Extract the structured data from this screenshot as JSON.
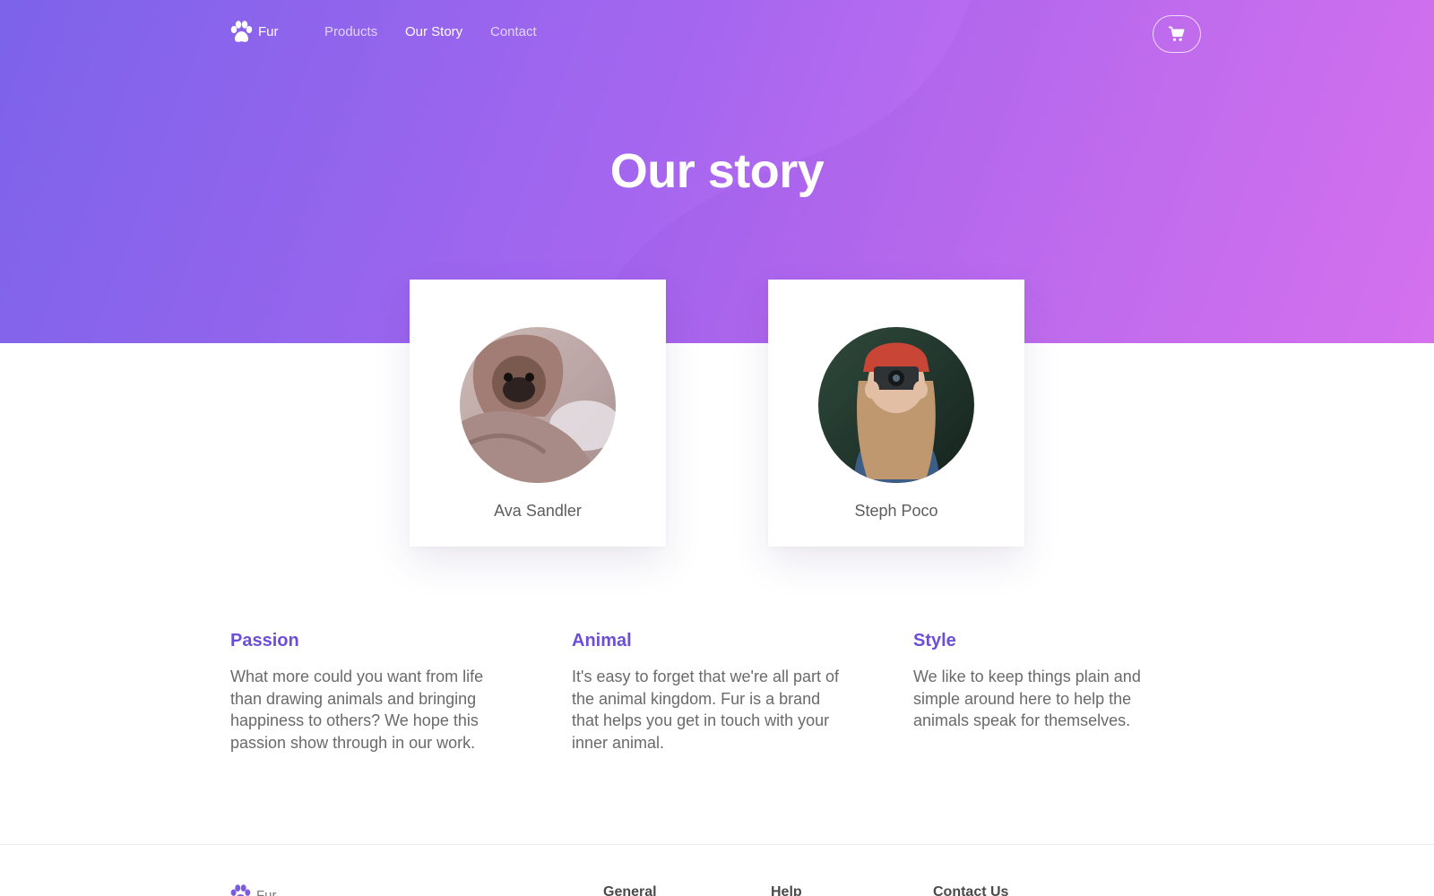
{
  "brand": {
    "name": "Fur",
    "logo_icon": "paw-icon"
  },
  "nav": {
    "items": [
      "Products",
      "Our Story",
      "Contact"
    ],
    "active": "Our Story"
  },
  "cart": {
    "icon": "cart-icon"
  },
  "hero": {
    "title": "Our story"
  },
  "team": [
    {
      "name": "Ava Sandler",
      "photo": "pug-wrapped-in-blanket"
    },
    {
      "name": "Steph Poco",
      "photo": "woman-with-red-beanie-holding-camera"
    }
  ],
  "features": [
    {
      "title": "Passion",
      "text": "What more could you want from life than drawing animals and bringing happiness to others? We hope this passion show through in our work."
    },
    {
      "title": "Animal",
      "text": "It's easy to forget that we're all part of the animal kingdom. Fur is a brand that helps you get in touch with your inner animal."
    },
    {
      "title": "Style",
      "text": "We like to keep things plain and simple around here to help the animals speak for themselves."
    }
  ],
  "footer": {
    "brand": "Fur",
    "columns": [
      "General",
      "Help",
      "Contact Us"
    ]
  },
  "colors": {
    "gradient_start": "#7c63ea",
    "gradient_end": "#dc76f1",
    "accent": "#6b4fd8",
    "body_text": "#6a6a6a"
  }
}
